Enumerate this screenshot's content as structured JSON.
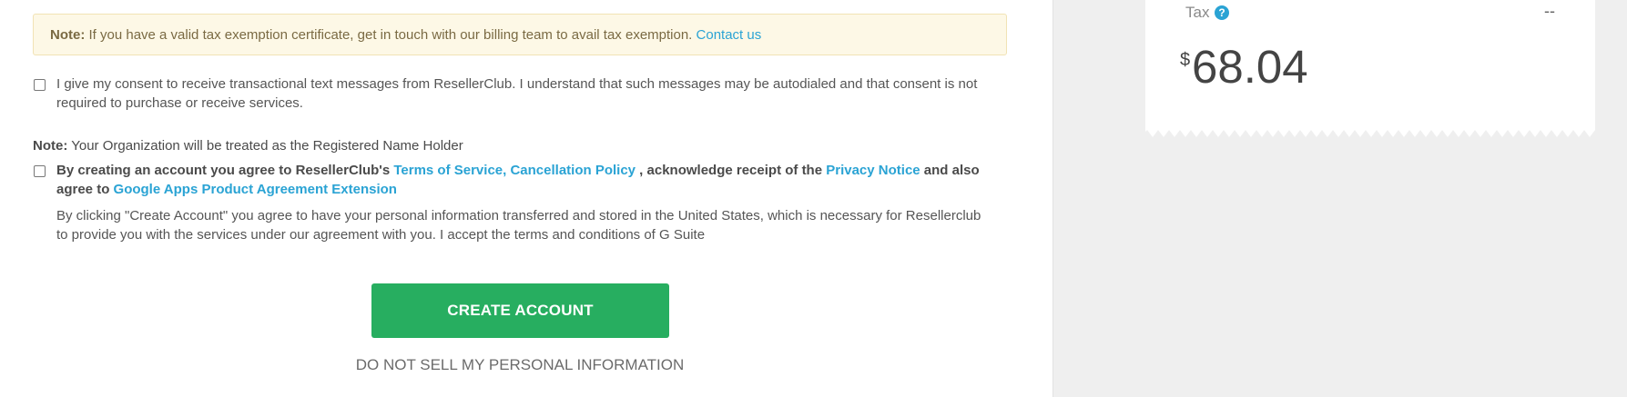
{
  "notice": {
    "label": "Note:",
    "text": " If you have a valid tax exemption certificate, get in touch with our billing team to avail tax exemption. ",
    "link": "Contact us"
  },
  "sms_consent": {
    "line1": "I give my consent to receive transactional text messages from ResellerClub. I understand that such messages may be autodialed and that consent is not",
    "line2": "required to purchase or receive services."
  },
  "registrant_note": {
    "label": "Note:",
    "text": " Your Organization will be treated as the Registered Name Holder"
  },
  "agreement": {
    "prefix": "By creating an account you agree to ResellerClub's ",
    "tos_link": "Terms of Service, Cancellation Policy",
    "middle": " , acknowledge receipt of the ",
    "privacy_link": "Privacy Notice",
    "suffix": " and also",
    "line2_prefix": "agree to ",
    "google_link": "Google Apps Product Agreement Extension",
    "detail_line1": "By clicking \"Create Account\" you agree to have your personal information transferred and stored in the United States, which is necessary for Resellerclub",
    "detail_line2": "to provide you with the services under our agreement with you. I accept the terms and conditions of G Suite"
  },
  "create_button": "CREATE ACCOUNT",
  "do_not_sell": "DO NOT SELL MY PERSONAL INFORMATION",
  "summary": {
    "tax_label": "Tax",
    "help_icon": "?",
    "tax_value": "--",
    "currency": "$",
    "total": "68.04"
  },
  "colors": {
    "accent": "#2aa3d4",
    "button": "#27ae60",
    "notice_bg": "#fdf8e6"
  }
}
